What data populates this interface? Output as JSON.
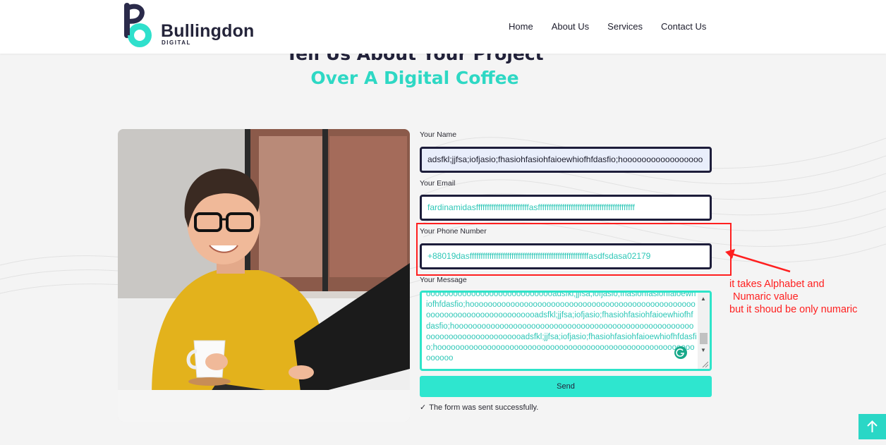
{
  "brand": {
    "name": "Bullingdon",
    "tagline": "DIGITAL",
    "colors": {
      "accent": "#2ed8c4",
      "dark": "#22223a",
      "annotation": "#ff1f1f"
    }
  },
  "nav": {
    "items": [
      "Home",
      "About Us",
      "Services",
      "Contact Us"
    ]
  },
  "heading": {
    "line1": "Tell Us About Your Project",
    "line2": "Over A Digital Coffee"
  },
  "form": {
    "name_label": "Your Name",
    "name_value": "adsfkl;jjfsa;iofjasio;fhasiohfasiohfaioewhiofhfdasfio;hooooooooooooooooo",
    "email_label": "Your Email",
    "email_value": "fardinamidasffffffffffffffffffffffffasffffffffffffffffffffffffffffffffffffffffffff",
    "phone_label": "Your Phone Number",
    "phone_value": "+88019dasffffffffffffffffffffffffffffffffffffffffffffffffffffffasdfsdasa02179",
    "message_label": "Your Message",
    "message_value": "ooooooooooooooooooooooooooooadsfkl;jjfsa;iofjasio;fhasiohfasiohfaioewhiofhfdasfio;hooooooooooooooooooooooooooooooooooooooooooooooooooooooooooooooooooooooooooadsfkl;jjfsa;iofjasio;fhasiohfasiohfaioewhiofhfdasfio;hooooooooooooooooooooooooooooooooooooooooooooooooooooooooooooooooooooooooooadsfkl;jjfsa;iofjasio;fhasiohfasiohfaioewhiofhfdasfio;hooooooooooooooooooooooooooooooooooooooooooooooooooooooooooooooo",
    "send_label": "Send",
    "success_text": "The form was sent successfully."
  },
  "annotation": {
    "line1": "it takes Alphabet and",
    "line2": "Numaric value",
    "line3": "but it shoud be only numaric"
  },
  "icons": {
    "check": "check-icon",
    "scroll_top": "arrow-up-icon",
    "grammar": "grammarly-icon"
  }
}
